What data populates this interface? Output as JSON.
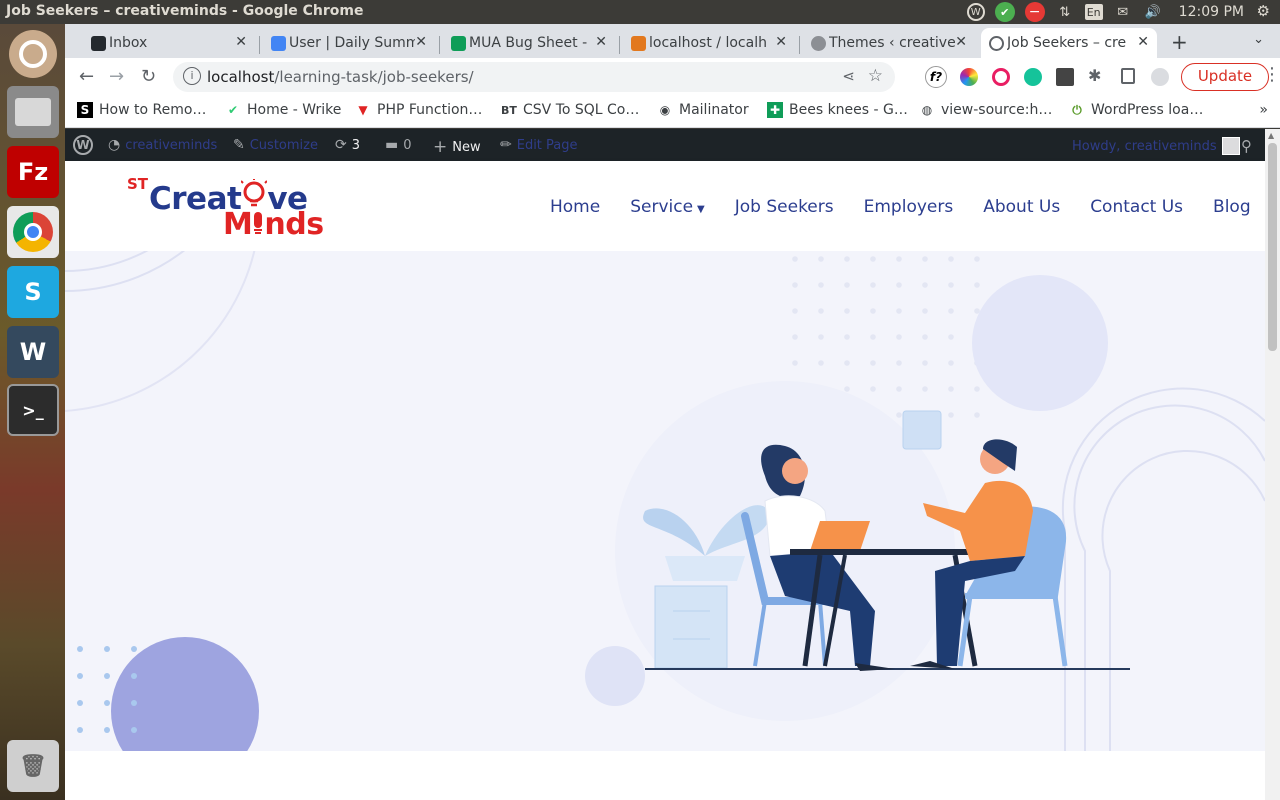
{
  "os": {
    "window_title": "Job Seekers – creativeminds - Google Chrome",
    "keyboard_layout": "En",
    "clock": "12:09 PM",
    "launcher": [
      "ubuntu-icon",
      "files-icon",
      "filezilla-icon",
      "chrome-icon",
      "skype-icon",
      "wunderlist-icon",
      "terminal-icon",
      "trash-icon"
    ]
  },
  "tabs": [
    {
      "label": "Inbox",
      "icon": "github-icon",
      "color": "#24292e"
    },
    {
      "label": "User | Daily Summ",
      "icon": "calendar-icon",
      "color": "#4285f4"
    },
    {
      "label": "MUA Bug Sheet -",
      "icon": "sheets-icon",
      "color": "#0f9d58"
    },
    {
      "label": "localhost / localh",
      "icon": "phpmyadmin-icon",
      "color": "#e2781e"
    },
    {
      "label": "Themes ‹ creative",
      "icon": "wordpress-icon",
      "color": "#8c8f94"
    },
    {
      "label": "Job Seekers – cre",
      "icon": "globe-icon",
      "color": "#5f6368"
    }
  ],
  "toolbar": {
    "url_host": "localhost",
    "url_path": "/learning-task/job-seekers/",
    "update_label": "Update"
  },
  "bookmarks": [
    {
      "label": "How to Remo…",
      "icon": "S",
      "color": "#000000"
    },
    {
      "label": "Home - Wrike",
      "icon": "✔",
      "color": "#2fcb73"
    },
    {
      "label": "PHP Function…",
      "icon": "▼",
      "color": "#e02424"
    },
    {
      "label": "CSV To SQL Co…",
      "icon": "BT",
      "color": "#222222"
    },
    {
      "label": "Mailinator",
      "icon": "◉",
      "color": "#333333"
    },
    {
      "label": "Bees knees - G…",
      "icon": "✚",
      "color": "#0f9d58"
    },
    {
      "label": "view-source:h…",
      "icon": "◍",
      "color": "#333333"
    },
    {
      "label": "WordPress loa…",
      "icon": "⏻",
      "color": "#5a9b2a"
    }
  ],
  "wp_admin_bar": {
    "site_name": "creativeminds",
    "customize": "Customize",
    "updates_count": "3",
    "comments_count": "0",
    "new_label": "New",
    "edit_page": "Edit Page",
    "howdy": "Howdy, creativeminds"
  },
  "site": {
    "logo_prefix": "ST",
    "logo_line1_a": "Creat",
    "logo_line1_b": "ve",
    "logo_line2_a": "M",
    "logo_line2_b": "nds",
    "nav": [
      "Home",
      "Service",
      "Job Seekers",
      "Employers",
      "About Us",
      "Contact Us",
      "Blog"
    ]
  },
  "colors": {
    "brand_blue": "#243a8c",
    "brand_red": "#e02424",
    "hero_bg": "#f3f4fb"
  }
}
